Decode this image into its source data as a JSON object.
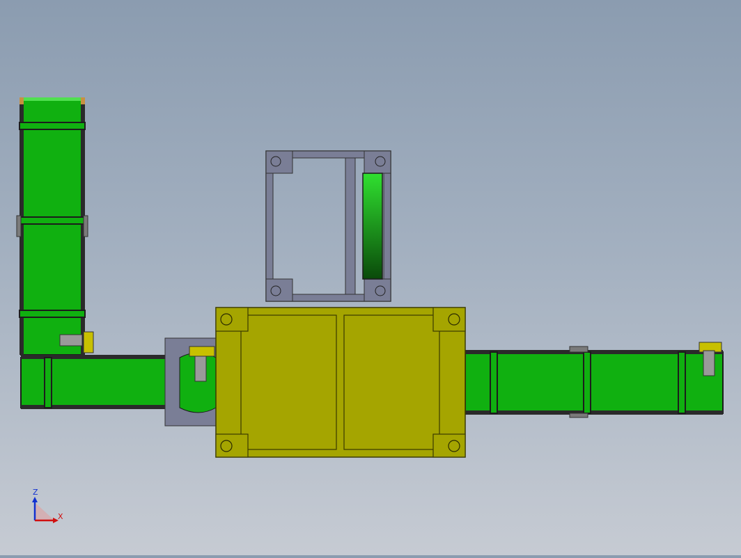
{
  "viewport": {
    "background_top": "#8b9cb0",
    "background_bottom": "#c6cbd3"
  },
  "colors": {
    "conveyor_green": "#10b010",
    "roller_green": "#18a018",
    "frame_dark": "#1c1c1c",
    "housing_yellow": "#a5a500",
    "housing_edge": "#3a3a00",
    "fixture_gray": "#7a7e96",
    "cylinder_gray": "#9a9a9a",
    "motor_yellow": "#c8c000",
    "axis_blue": "#1030d0",
    "axis_red": "#d01010"
  },
  "triad": {
    "z_label": "Z",
    "x_label": "X"
  }
}
